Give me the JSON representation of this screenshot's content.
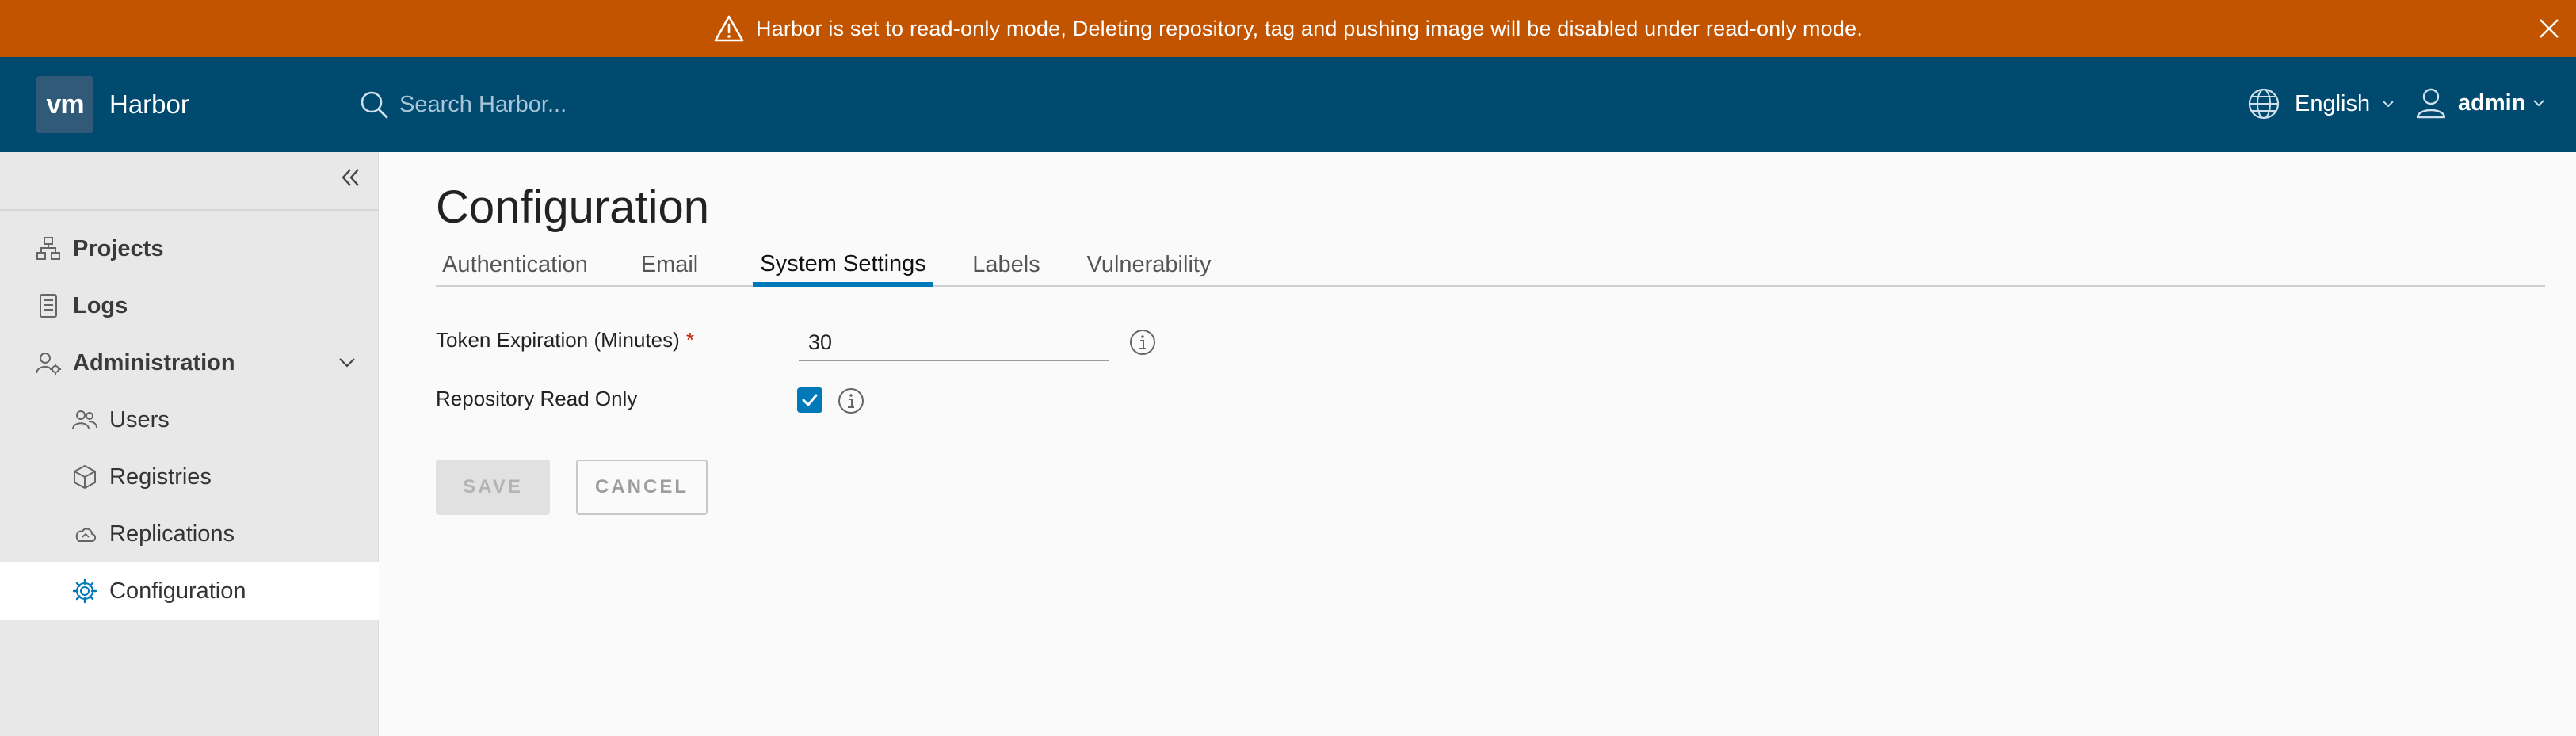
{
  "banner": {
    "message": "Harbor is set to read-only mode, Deleting repository, tag and pushing image will be disabled under read-only mode.",
    "warning_icon": "warning-triangle-icon",
    "close_icon": "close-icon",
    "color": "#c25400"
  },
  "header": {
    "logo_text": "vm",
    "app_title": "Harbor",
    "search": {
      "placeholder": "Search Harbor...",
      "value": ""
    },
    "language": {
      "label": "English",
      "icon": "globe-icon"
    },
    "user": {
      "label": "admin",
      "icon": "user-icon"
    },
    "color": "#004a70"
  },
  "sidebar": {
    "collapse_icon": "double-chevron-left-icon",
    "items": [
      {
        "label": "Projects",
        "icon": "projects-icon"
      },
      {
        "label": "Logs",
        "icon": "logs-icon"
      },
      {
        "label": "Administration",
        "icon": "admin-icon",
        "expanded": true
      },
      {
        "label": "Users",
        "icon": "users-icon"
      },
      {
        "label": "Registries",
        "icon": "registries-icon"
      },
      {
        "label": "Replications",
        "icon": "cloud-icon"
      },
      {
        "label": "Configuration",
        "icon": "gear-icon",
        "active": true
      }
    ]
  },
  "main": {
    "title": "Configuration",
    "tabs": [
      {
        "label": "Authentication"
      },
      {
        "label": "Email"
      },
      {
        "label": "System Settings",
        "active": true
      },
      {
        "label": "Labels"
      },
      {
        "label": "Vulnerability"
      }
    ],
    "form": {
      "token_expiration": {
        "label": "Token Expiration (Minutes)",
        "required_marker": "*",
        "value": "30"
      },
      "read_only": {
        "label": "Repository Read Only",
        "checked": true
      }
    },
    "buttons": {
      "save": "SAVE",
      "cancel": "CANCEL"
    },
    "accent_color": "#0079b8"
  }
}
